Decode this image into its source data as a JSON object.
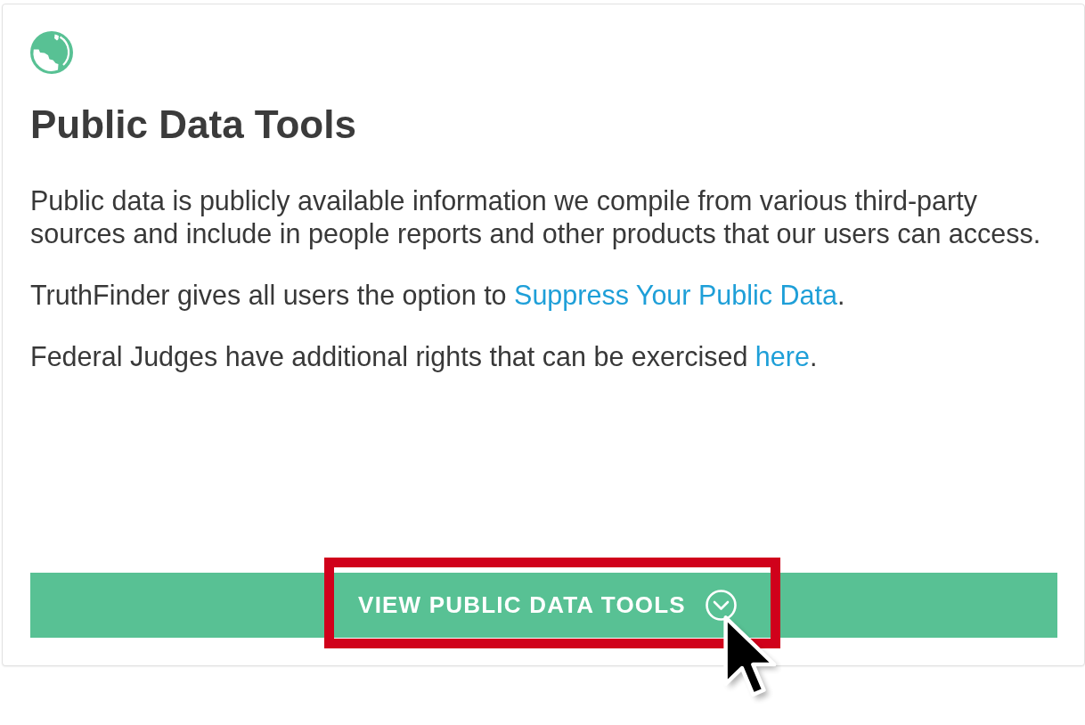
{
  "card": {
    "title": "Public Data Tools",
    "paragraphs": [
      {
        "parts": [
          {
            "kind": "text",
            "text": "Public data is publicly available information we compile from various third-party sources and include in people reports and other products that our users can access."
          }
        ]
      },
      {
        "parts": [
          {
            "kind": "text",
            "text": "TruthFinder gives all users the option to "
          },
          {
            "kind": "link",
            "text": "Suppress Your Public Data"
          },
          {
            "kind": "text",
            "text": "."
          }
        ]
      },
      {
        "parts": [
          {
            "kind": "text",
            "text": "Federal Judges have additional rights that can be exercised "
          },
          {
            "kind": "link",
            "text": "here"
          },
          {
            "kind": "text",
            "text": "."
          }
        ]
      }
    ],
    "button": {
      "label": "VIEW PUBLIC DATA TOOLS",
      "highlighted": true,
      "hovered": true
    }
  }
}
